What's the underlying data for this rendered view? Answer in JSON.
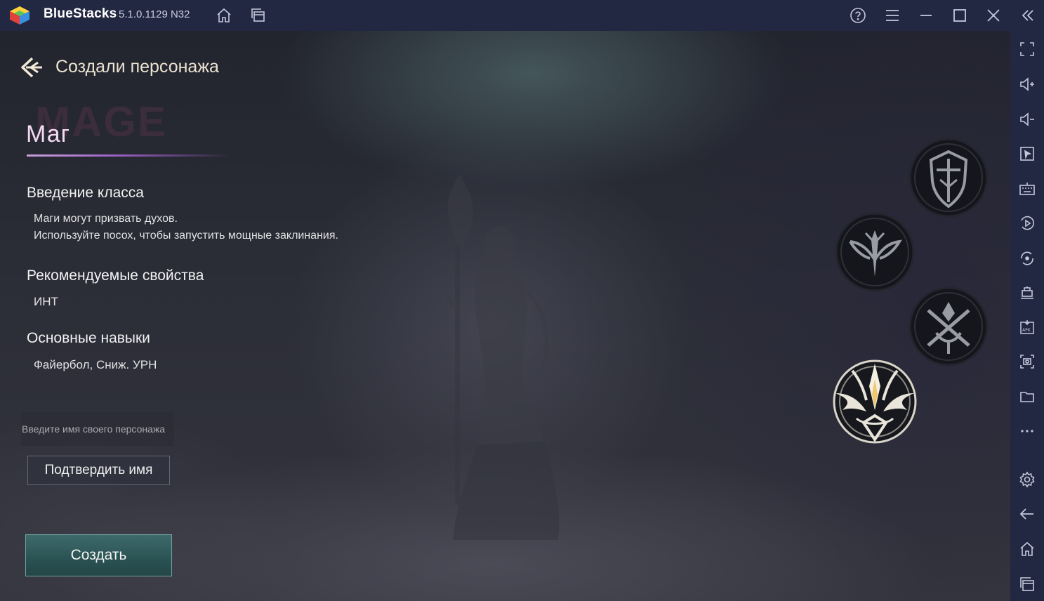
{
  "app": {
    "name": "BlueStacks",
    "version": "5.1.0.1129 N32"
  },
  "titlebar": {
    "icons": [
      "home-icon",
      "multi-instance-icon",
      "help-icon",
      "menu-icon",
      "minimize-icon",
      "maximize-icon",
      "close-icon",
      "collapse-sidebar-icon"
    ]
  },
  "sidebar": {
    "icons": [
      "fullscreen-icon",
      "volume-up-icon",
      "volume-down-icon",
      "cursor-lock-icon",
      "keyboard-icon",
      "macro-record-icon",
      "rotate-icon",
      "game-mode-icon",
      "apk-install-icon",
      "screenshot-icon",
      "folder-icon",
      "more-icon",
      "settings-icon",
      "back-icon",
      "home-icon",
      "recent-apps-icon"
    ]
  },
  "game": {
    "header": {
      "title": "Создали персонажа"
    },
    "class": {
      "watermark": "MAGE",
      "name": "Маг"
    },
    "sections": {
      "intro_title": "Введение класса",
      "intro_line1": "Маги могут призвать духов.",
      "intro_line2": "Используйте посох, чтобы запустить мощные заклинания.",
      "props_title": "Рекомендуемые свойства",
      "props_value": "ИНТ",
      "skills_title": "Основные навыки",
      "skills_value": "Файербол, Сниж. УРН"
    },
    "name_input": {
      "placeholder": "Введите имя своего персонажа",
      "value": ""
    },
    "confirm_label": "Подтвердить имя",
    "create_label": "Создать",
    "class_emblems": [
      "knight-emblem",
      "archer-emblem",
      "assassin-emblem",
      "mage-emblem"
    ],
    "selected_emblem": "mage-emblem"
  },
  "colors": {
    "chrome": "#232842",
    "title_text": "#ece4d2",
    "class_name": "#f3d9f1",
    "accent_purple": "#9a5fc3",
    "create_button": "#2a5253"
  }
}
